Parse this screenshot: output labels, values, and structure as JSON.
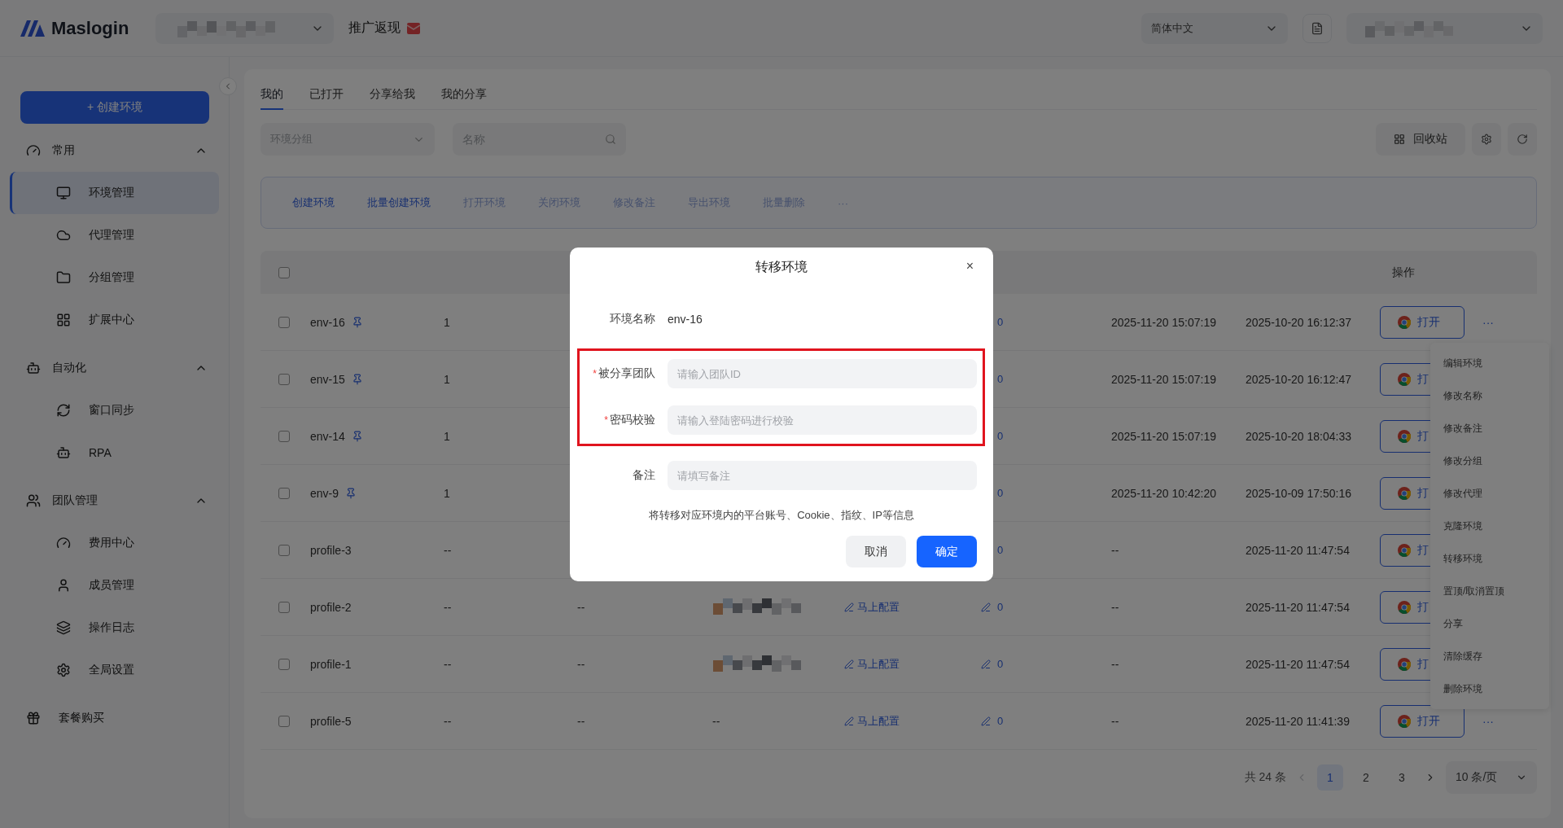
{
  "topbar": {
    "logo": "Maslogin",
    "promo": "推广返现",
    "language": "简体中文"
  },
  "sidebar": {
    "create_button": "+ 创建环境",
    "groups": [
      {
        "label": "常用",
        "expanded": true,
        "items": [
          {
            "label": "环境管理",
            "selected": true
          },
          {
            "label": "代理管理",
            "selected": false
          },
          {
            "label": "分组管理",
            "selected": false
          },
          {
            "label": "扩展中心",
            "selected": false
          }
        ]
      },
      {
        "label": "自动化",
        "expanded": true,
        "items": [
          {
            "label": "窗口同步",
            "selected": false
          },
          {
            "label": "RPA",
            "selected": false
          }
        ]
      },
      {
        "label": "团队管理",
        "expanded": true,
        "items": [
          {
            "label": "费用中心",
            "selected": false
          },
          {
            "label": "成员管理",
            "selected": false
          },
          {
            "label": "操作日志",
            "selected": false
          },
          {
            "label": "全局设置",
            "selected": false
          }
        ]
      }
    ],
    "footer_item": "套餐购买"
  },
  "tabs": [
    {
      "label": "我的",
      "selected": true
    },
    {
      "label": "已打开",
      "selected": false
    },
    {
      "label": "分享给我",
      "selected": false
    },
    {
      "label": "我的分享",
      "selected": false
    }
  ],
  "filters": {
    "group_placeholder": "环境分组",
    "name_placeholder": "名称",
    "recycle_button": "回收站"
  },
  "actions": [
    {
      "label": "创建环境",
      "disabled": false
    },
    {
      "label": "批量创建环境",
      "disabled": false
    },
    {
      "label": "打开环境",
      "disabled": true
    },
    {
      "label": "关闭环境",
      "disabled": true
    },
    {
      "label": "修改备注",
      "disabled": true
    },
    {
      "label": "导出环境",
      "disabled": true
    },
    {
      "label": "批量删除",
      "disabled": true
    },
    {
      "label": "···",
      "disabled": true
    }
  ],
  "table": {
    "header_checked": false,
    "action_header": "操作",
    "rows": [
      {
        "checked": false,
        "name": "env-16",
        "pinned": true,
        "column_2": "1",
        "count_icon": false,
        "count": "0",
        "time_1": "2025-11-20 15:07:19",
        "time_2": "2025-10-20 16:12:37",
        "open": "打开",
        "more": "···"
      },
      {
        "checked": false,
        "name": "env-15",
        "pinned": true,
        "column_2": "1",
        "count_icon": false,
        "count": "0",
        "time_1": "2025-11-20 15:07:19",
        "time_2": "2025-10-20 16:12:47",
        "open": "打"
      },
      {
        "checked": false,
        "name": "env-14",
        "pinned": true,
        "column_2": "1",
        "count_icon": false,
        "count": "0",
        "time_1": "2025-11-20 15:07:19",
        "time_2": "2025-10-20 18:04:33",
        "open": "打"
      },
      {
        "checked": false,
        "name": "env-9",
        "pinned": true,
        "column_2": "1",
        "count_icon": false,
        "count": "0",
        "time_1": "2025-11-20 10:42:20",
        "time_2": "2025-10-09 17:50:16",
        "open": "打"
      },
      {
        "checked": false,
        "name": "profile-3",
        "pinned": false,
        "column_2": "--",
        "count_icon": false,
        "count": "0",
        "time_1": "--",
        "time_2": "2025-11-20 11:47:54",
        "open": "打"
      },
      {
        "checked": false,
        "name": "profile-2",
        "pinned": false,
        "column_2": "--",
        "column_3": "--",
        "column_4": {
          "kind": "mosaic"
        },
        "link": "马上配置",
        "count_icon": true,
        "count": "0",
        "time_1": "--",
        "time_2": "2025-11-20 11:47:54",
        "open": "打"
      },
      {
        "checked": false,
        "name": "profile-1",
        "pinned": false,
        "column_2": "--",
        "column_3": "--",
        "column_4": {
          "kind": "mosaic"
        },
        "link": "马上配置",
        "count_icon": true,
        "count": "0",
        "time_1": "--",
        "time_2": "2025-11-20 11:47:54",
        "open": "打"
      },
      {
        "checked": false,
        "name": "profile-5",
        "pinned": false,
        "column_2": "--",
        "column_3": "--",
        "column_4": {
          "kind": "text",
          "text": "--"
        },
        "link": "马上配置",
        "count_icon": true,
        "count": "0",
        "time_1": "--",
        "time_2": "2025-11-20 11:41:39",
        "open": "打开",
        "more": "···"
      }
    ]
  },
  "row_menu": [
    "编辑环境",
    "修改名称",
    "修改备注",
    "修改分组",
    "修改代理",
    "克隆环境",
    "转移环境",
    "置顶/取消置顶",
    "分享",
    "清除缓存",
    "删除环境"
  ],
  "pagination": {
    "total": "共 24 条",
    "prev_disabled": true,
    "pages": [
      {
        "label": "1",
        "selected": true
      },
      {
        "label": "2",
        "selected": false
      },
      {
        "label": "3",
        "selected": false
      }
    ],
    "page_size": "10 条/页"
  },
  "modal": {
    "title": "转移环境",
    "close": "×",
    "required_mark": "*",
    "name_label": "环境名称",
    "name_value": "env-16",
    "fields": [
      {
        "label": "被分享团队",
        "required": true,
        "placeholder": "请输入团队ID",
        "highlighted": true
      },
      {
        "label": "密码校验",
        "required": true,
        "placeholder": "请输入登陆密码进行校验",
        "highlighted": true
      },
      {
        "label": "备注",
        "required": false,
        "placeholder": "请填写备注",
        "highlighted": false
      }
    ],
    "note": "将转移对应环境内的平台账号、Cookie、指纹、IP等信息",
    "cancel": "取消",
    "confirm": "确定"
  }
}
